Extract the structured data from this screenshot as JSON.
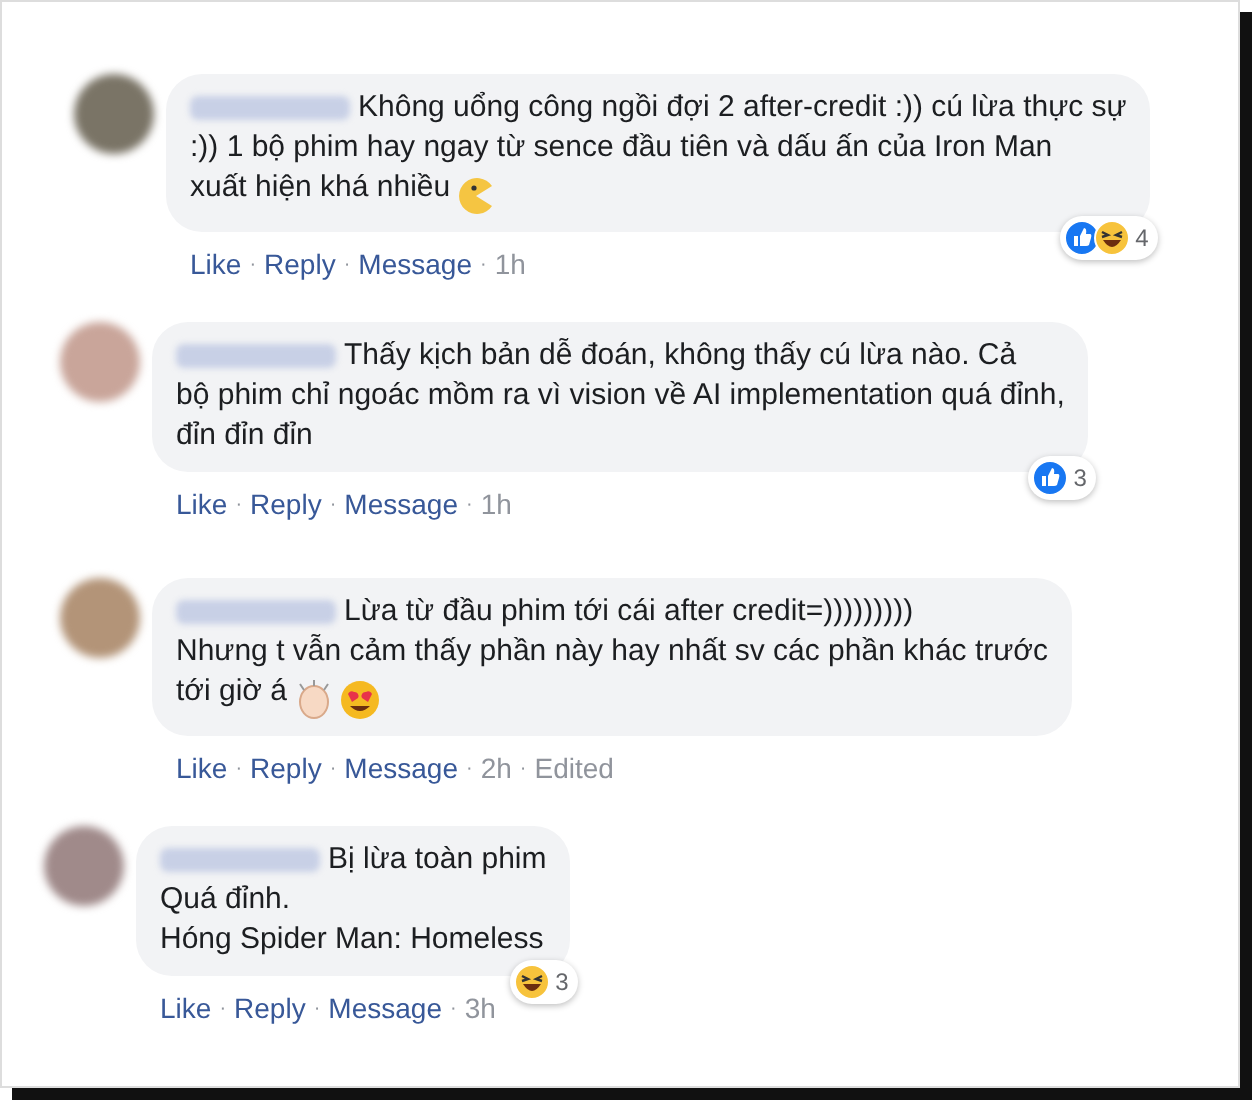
{
  "comments": [
    {
      "lines": [
        "Không uổng công ngồi đợi 2 after-credit :)) cú lừa thực sự",
        ":)) 1 bộ phim hay ngay từ sence đầu tiên và dấu ấn của Iron Man",
        "xuất hiện khá nhiều"
      ],
      "emojis": [
        {
          "kind": "pacman"
        }
      ],
      "reactions": [
        {
          "kind": "like"
        },
        {
          "kind": "haha"
        }
      ],
      "reaction_count": "4",
      "actions": [
        "Like",
        "·",
        "Reply",
        "·",
        "Message",
        "·",
        "1h"
      ]
    },
    {
      "lines": [
        "Thấy kịch bản dễ đoán, không thấy cú lừa nào. Cả",
        "bộ phim chỉ ngoác mồm ra vì vision về AI implementation quá đỉnh,",
        "đỉn đỉn đỉn"
      ],
      "reactions": [
        {
          "kind": "like"
        }
      ],
      "reaction_count": "3",
      "actions": [
        "Like",
        "·",
        "Reply",
        "·",
        "Message",
        "·",
        "1h"
      ]
    },
    {
      "lines": [
        "Lừa từ đầu phim tới cái after credit=)))))))))",
        "Nhưng t vẫn cảm thấy phần này hay nhất sv các phần khác trước",
        "tới giờ á"
      ],
      "emojis": [
        {
          "kind": "clap"
        },
        {
          "kind": "heart-eyes"
        }
      ],
      "actions": [
        "Like",
        "·",
        "Reply",
        "·",
        "Message",
        "·",
        "2h",
        "·",
        "Edited"
      ]
    },
    {
      "lines": [
        "Bị lừa toàn phim",
        "Quá đỉnh.",
        "Hóng Spider Man: Homeless"
      ],
      "reactions": [
        {
          "kind": "haha"
        }
      ],
      "reaction_count": "3",
      "actions": [
        "Like",
        "·",
        "Reply",
        "·",
        "Message",
        "·",
        "3h"
      ]
    }
  ]
}
